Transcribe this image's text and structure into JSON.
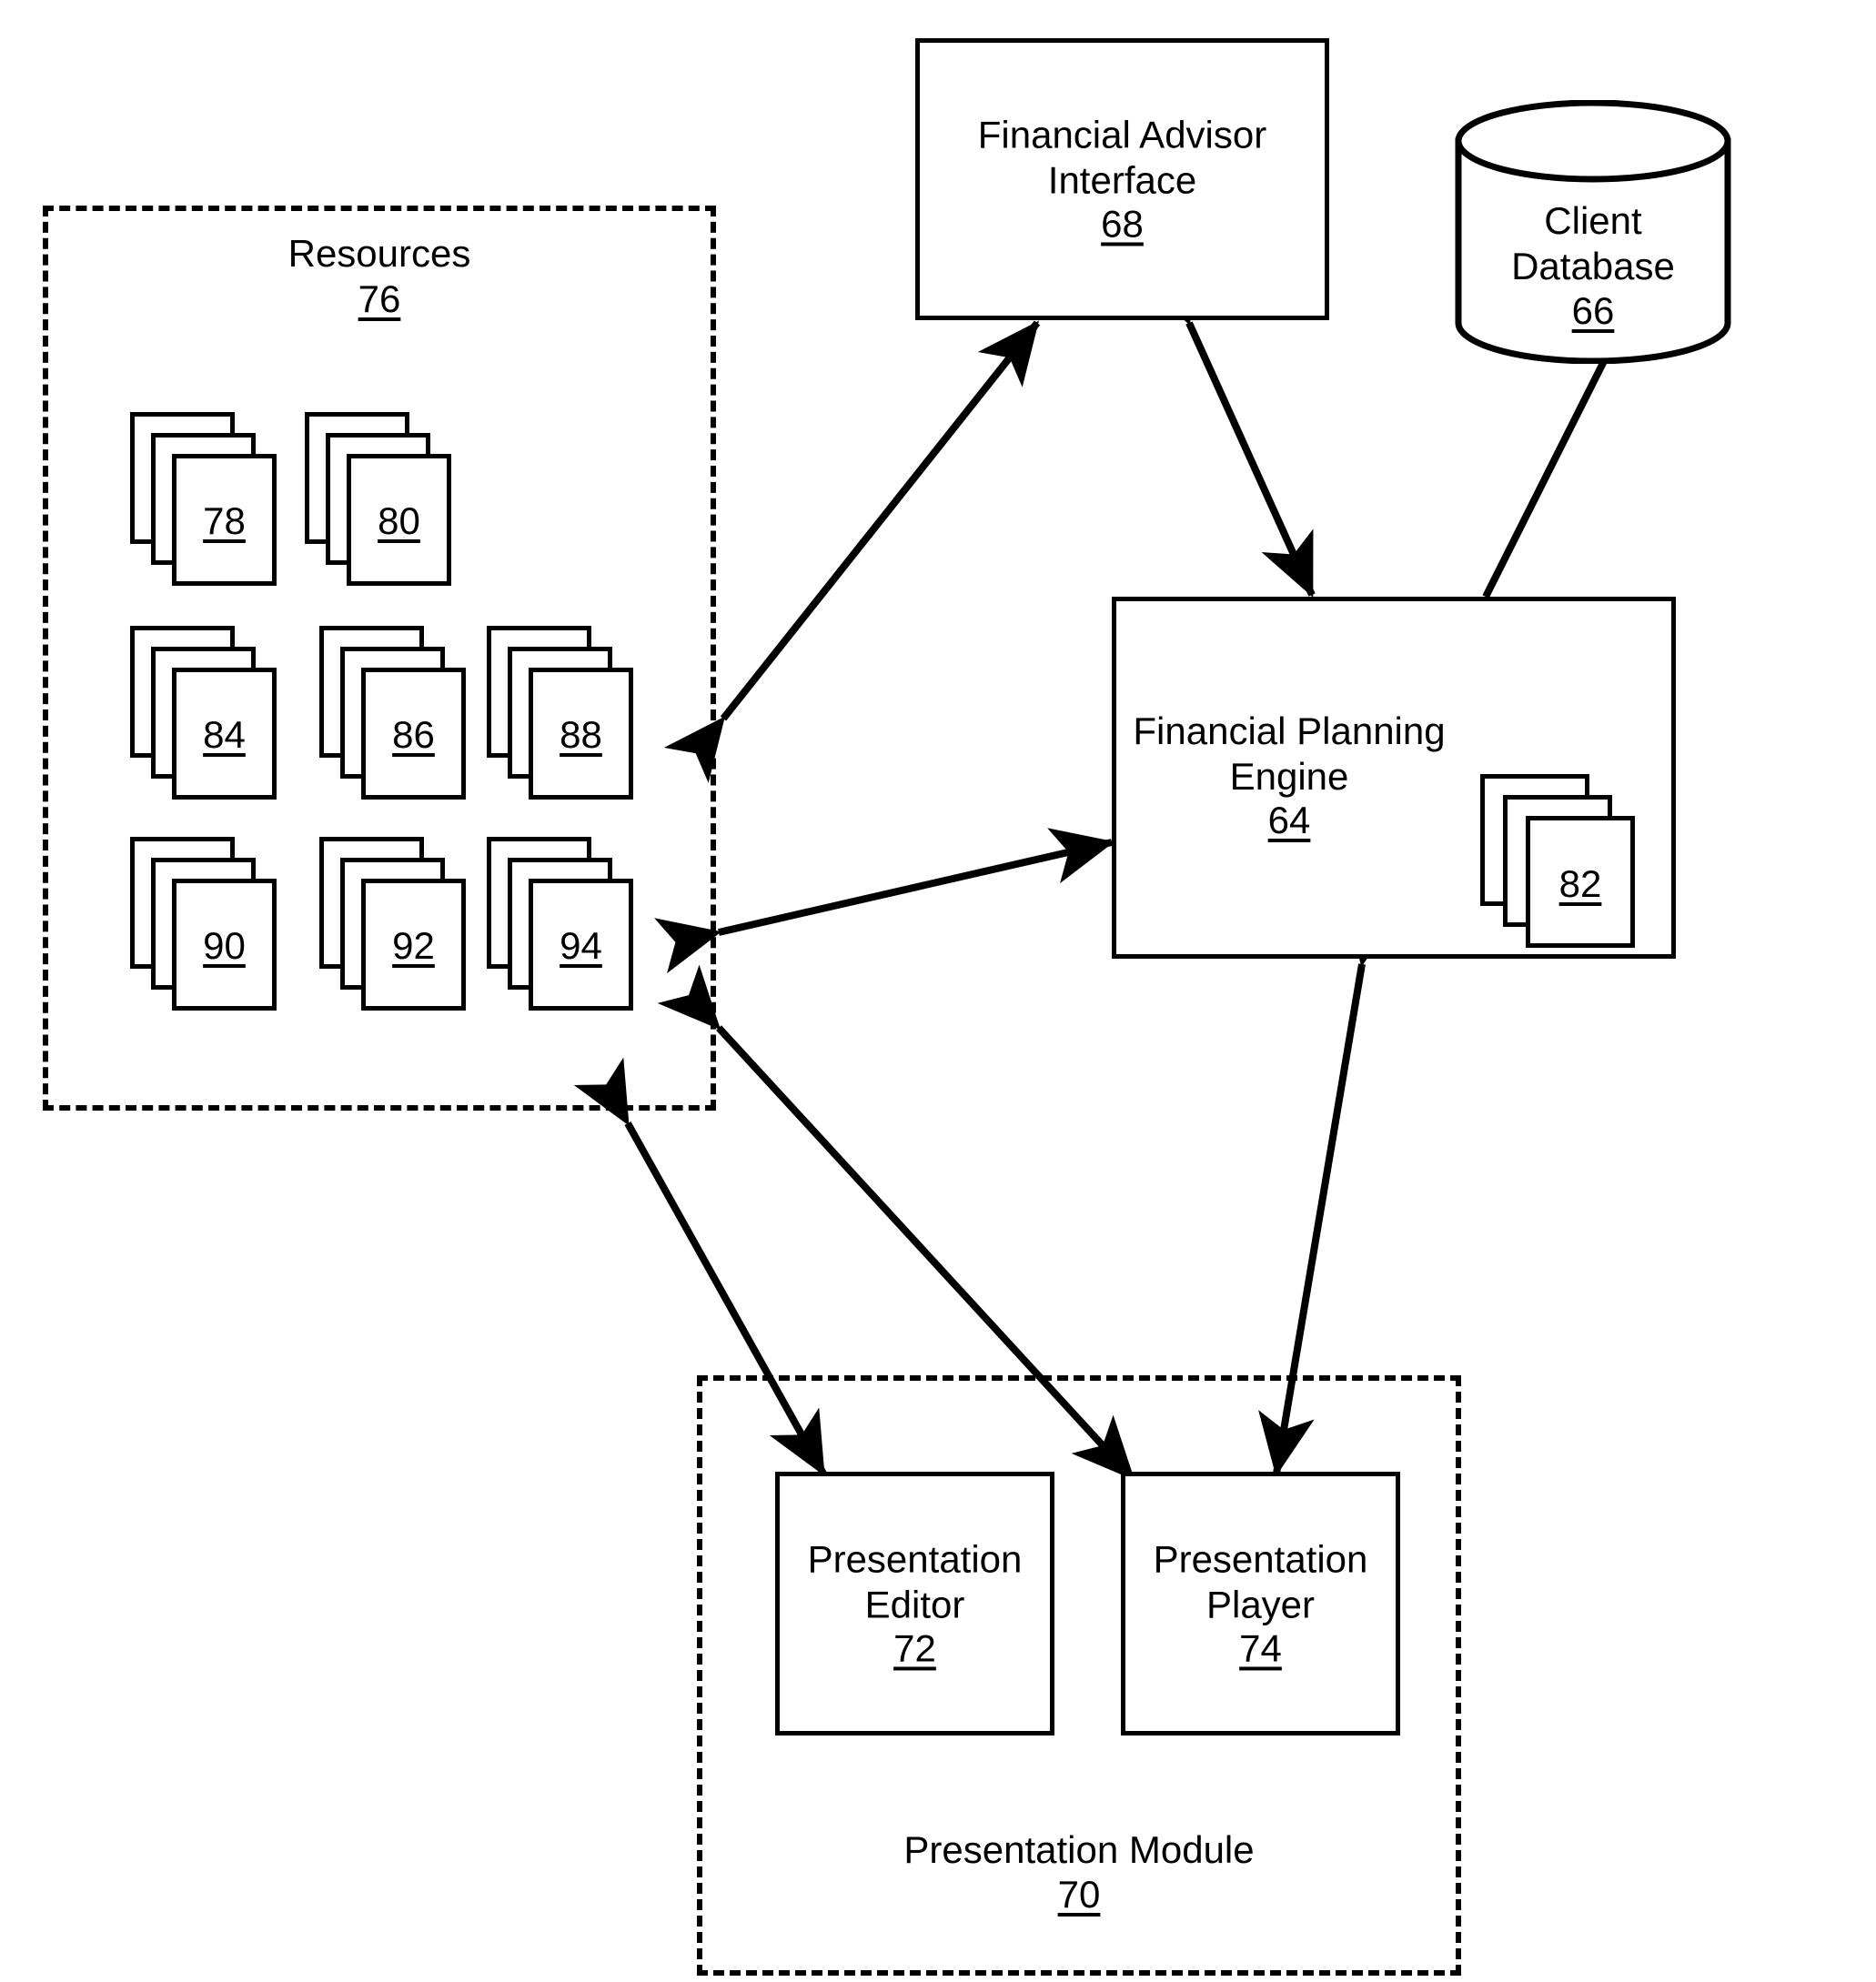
{
  "figure": {
    "type": "patent-block-diagram",
    "background": "#ffffff",
    "line_color": "#000000"
  },
  "nodes": {
    "financial_advisor_interface": {
      "label": "Financial Advisor\nInterface",
      "ref": "68",
      "shape": "rectangle"
    },
    "client_database": {
      "label": "Client\nDatabase",
      "ref": "66",
      "shape": "cylinder"
    },
    "financial_planning_engine": {
      "label": "Financial Planning\nEngine",
      "ref": "64",
      "shape": "rectangle"
    },
    "resources_group": {
      "label": "Resources",
      "ref": "76",
      "shape": "dashed-rectangle"
    },
    "presentation_module": {
      "label": "Presentation Module",
      "ref": "70",
      "shape": "dashed-rectangle"
    },
    "presentation_editor": {
      "label": "Presentation\nEditor",
      "ref": "72",
      "shape": "rectangle"
    },
    "presentation_player": {
      "label": "Presentation\nPlayer",
      "ref": "74",
      "shape": "rectangle"
    }
  },
  "document_stacks": {
    "inside_engine": [
      {
        "ref": "82"
      }
    ],
    "inside_resources": [
      {
        "ref": "78"
      },
      {
        "ref": "80"
      },
      {
        "ref": "84"
      },
      {
        "ref": "86"
      },
      {
        "ref": "88"
      },
      {
        "ref": "90"
      },
      {
        "ref": "92"
      },
      {
        "ref": "94"
      }
    ]
  },
  "connections": [
    {
      "from": "resources_group",
      "to": "financial_advisor_interface",
      "arrows": "both"
    },
    {
      "from": "financial_advisor_interface",
      "to": "financial_planning_engine",
      "arrows": "both"
    },
    {
      "from": "client_database",
      "to": "financial_planning_engine",
      "arrows": "none"
    },
    {
      "from": "resources_group",
      "to": "financial_planning_engine",
      "arrows": "both"
    },
    {
      "from": "resources_group",
      "to": "presentation_editor",
      "arrows": "both"
    },
    {
      "from": "resources_group",
      "to": "presentation_player",
      "arrows": "both"
    },
    {
      "from": "financial_planning_engine",
      "to": "presentation_player",
      "arrows": "both"
    }
  ]
}
